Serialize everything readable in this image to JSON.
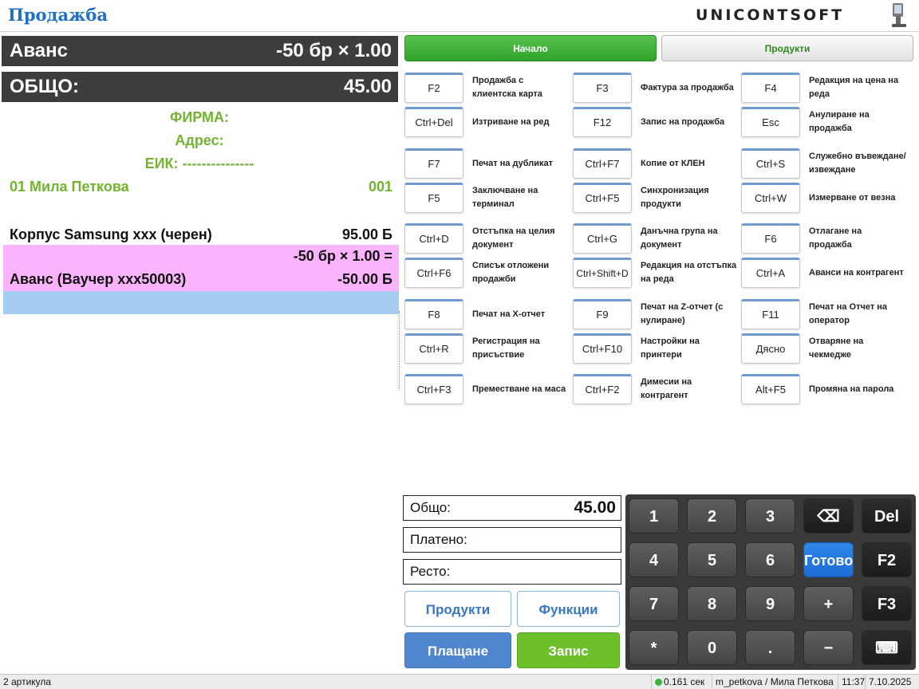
{
  "app": {
    "title": "Продажба",
    "logo": "UNICONTSOFT"
  },
  "receipt": {
    "header_row": {
      "label": "Аванс",
      "value": "-50 бр × 1.00"
    },
    "total_row": {
      "label": "ОБЩО:",
      "value": "45.00"
    },
    "company": "ФИРМА:",
    "address": "Адрес:",
    "eik": "ЕИК: ---------------",
    "operator": {
      "name": "01 Мила Петкова",
      "code": "001"
    },
    "items": [
      {
        "name": "Корпус Samsung xxx (черен)",
        "amount": "95.00 Б"
      },
      {
        "qty": "-50 бр × 1.00 =",
        "name": "Аванс (Ваучер xxx50003)",
        "amount": "-50.00 Б"
      }
    ]
  },
  "tabs": {
    "start": "Начало",
    "products": "Продукти"
  },
  "functions": [
    {
      "key": "F2",
      "label": "Продажба с клиентска карта"
    },
    {
      "key": "F3",
      "label": "Фактура за продажба"
    },
    {
      "key": "F4",
      "label": "Редакция на цена на реда"
    },
    {
      "key": "Ctrl+Del",
      "label": "Изтриване на ред"
    },
    {
      "key": "F12",
      "label": "Запис на продажба"
    },
    {
      "key": "Esc",
      "label": "Анулиране на продажба"
    },
    {
      "key": "F7",
      "label": "Печат на дубликат"
    },
    {
      "key": "Ctrl+F7",
      "label": "Копие от КЛЕН"
    },
    {
      "key": "Ctrl+S",
      "label": "Служебно въвеждане/извеждане"
    },
    {
      "key": "F5",
      "label": "Заключване на терминал"
    },
    {
      "key": "Ctrl+F5",
      "label": "Синхронизация продукти"
    },
    {
      "key": "Ctrl+W",
      "label": "Измерване от везна"
    },
    {
      "key": "Ctrl+D",
      "label": "Отстъпка на целия документ"
    },
    {
      "key": "Ctrl+G",
      "label": "Данъчна група на документ"
    },
    {
      "key": "F6",
      "label": "Отлагане на продажба"
    },
    {
      "key": "Ctrl+F6",
      "label": "Списък отложени продажби"
    },
    {
      "key": "Ctrl+Shift+D",
      "label": "Редакция на отстъпка на реда"
    },
    {
      "key": "Ctrl+A",
      "label": "Аванси на контрагент"
    },
    {
      "key": "F8",
      "label": "Печат на X-отчет"
    },
    {
      "key": "F9",
      "label": "Печат на Z-отчет (с нулиране)"
    },
    {
      "key": "F11",
      "label": "Печат на Отчет на оператор"
    },
    {
      "key": "Ctrl+R",
      "label": "Регистрация на присъствие"
    },
    {
      "key": "Ctrl+F10",
      "label": "Настройки на принтери"
    },
    {
      "key": "Дясно",
      "label": "Отваряне на чекмедже"
    },
    {
      "key": "Ctrl+F3",
      "label": "Преместване на маса"
    },
    {
      "key": "Ctrl+F2",
      "label": "Димесии на контрагент"
    },
    {
      "key": "Alt+F5",
      "label": "Промяна на парола"
    }
  ],
  "totals": {
    "total_label": "Общо:",
    "total_value": "45.00",
    "paid_label": "Платено:",
    "paid_value": "",
    "change_label": "Ресто:",
    "change_value": ""
  },
  "actions": {
    "products": "Продукти",
    "functions": "Функции",
    "pay": "Плащане",
    "save": "Запис"
  },
  "keypad": {
    "keys": [
      "1",
      "2",
      "3",
      "⌫",
      "Del",
      "4",
      "5",
      "6",
      "Готово",
      "F2",
      "7",
      "8",
      "9",
      "+",
      "F3",
      "*",
      "0",
      ".",
      "−",
      "⌨"
    ]
  },
  "status": {
    "articles": "2 артикула",
    "latency": "0.161 сек",
    "user": "m_petkova / Мила Петкова",
    "time": "11:37",
    "date": "7.10.2025 г."
  }
}
